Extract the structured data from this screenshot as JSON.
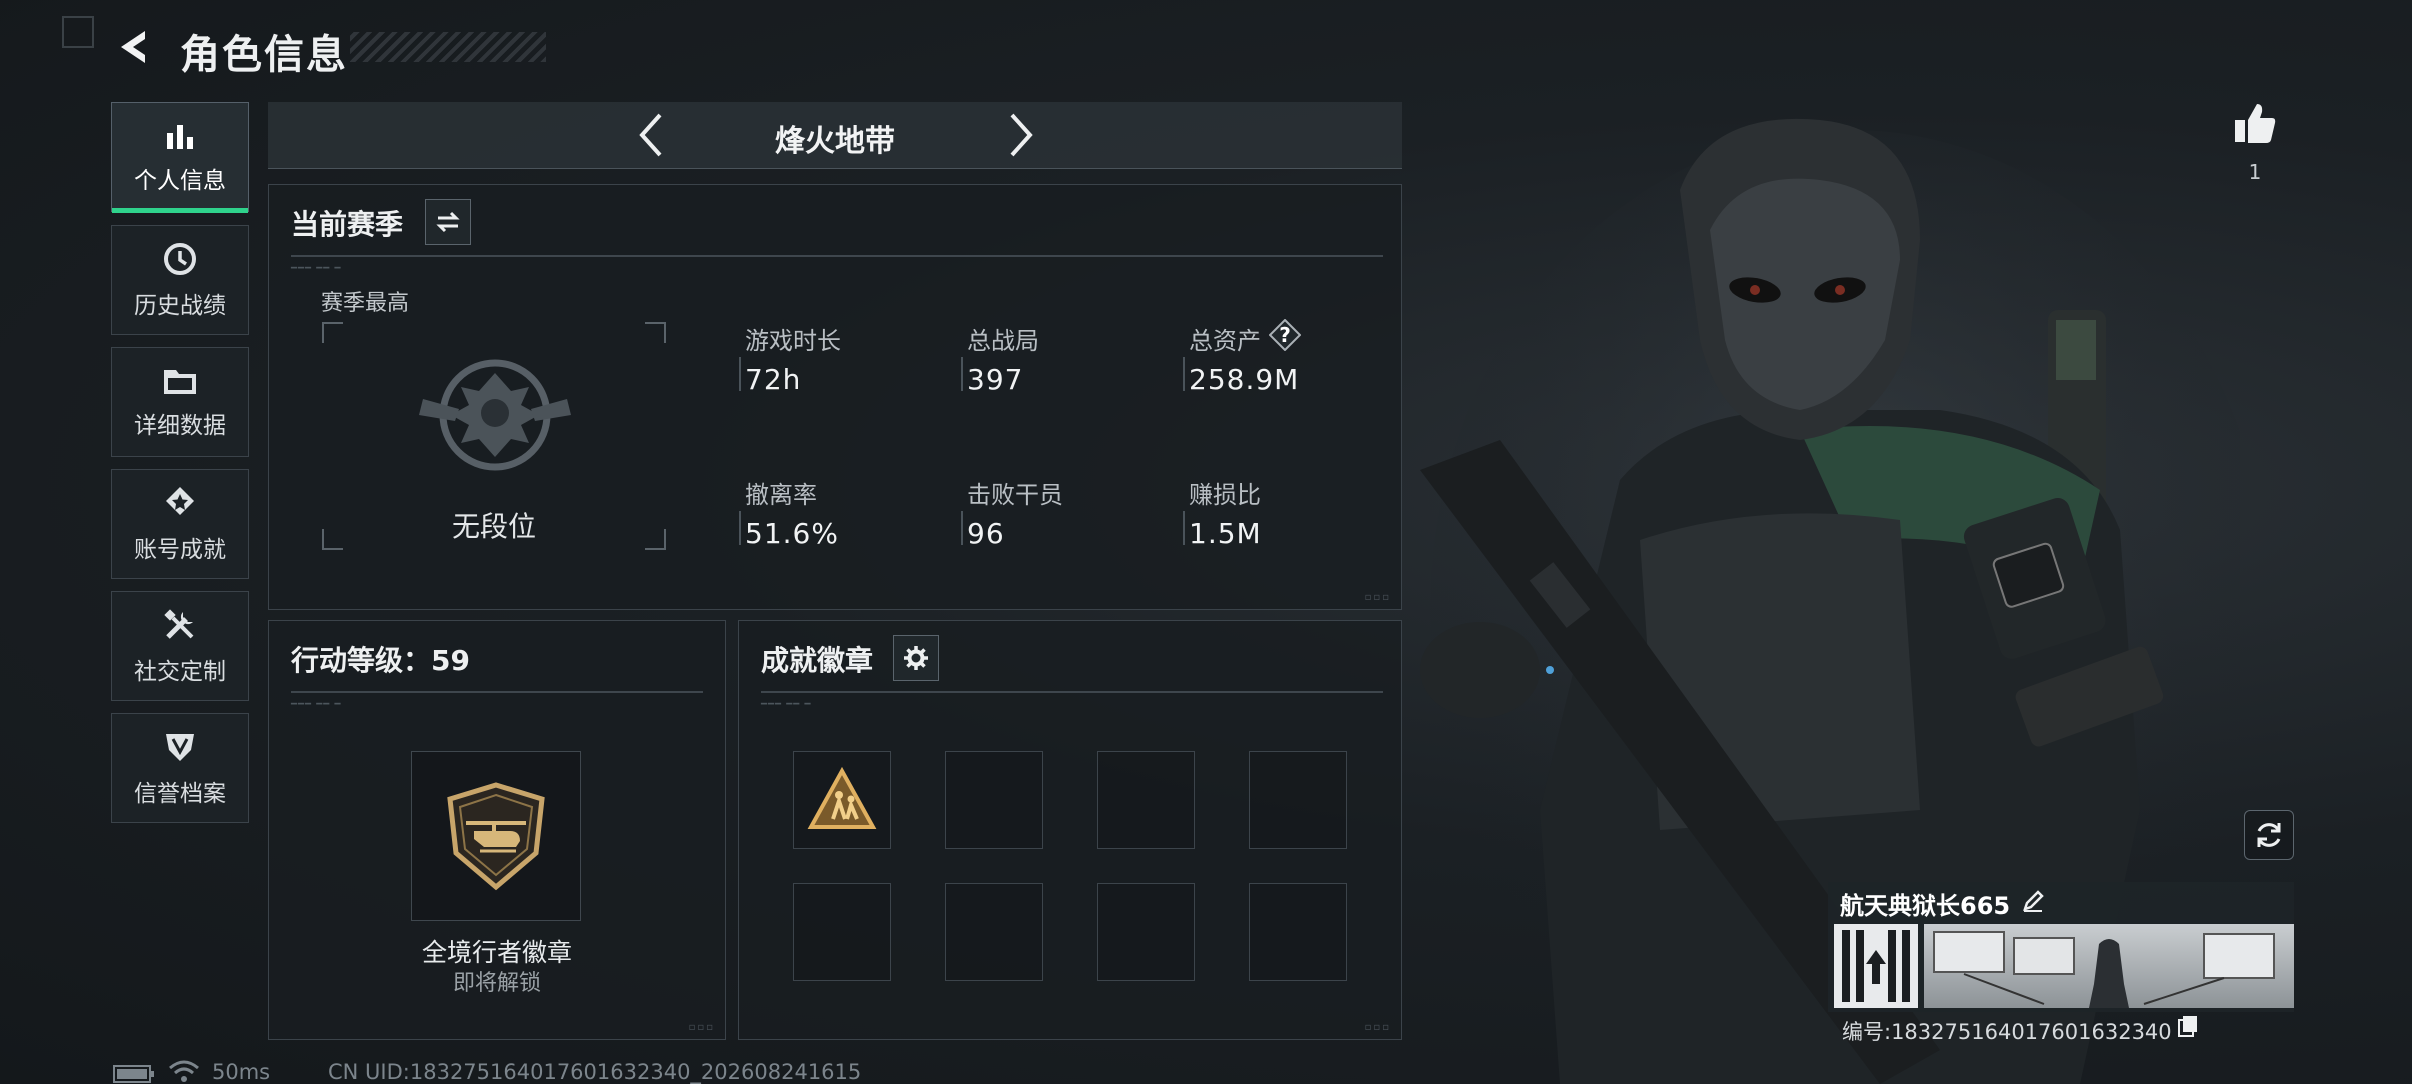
{
  "header": {
    "title": "角色信息",
    "back_icon": "back-arrow-icon"
  },
  "sidebar": {
    "items": [
      {
        "label": "个人信息",
        "icon": "bar-chart-icon",
        "active": true
      },
      {
        "label": "历史战绩",
        "icon": "history-clock-icon",
        "active": false
      },
      {
        "label": "详细数据",
        "icon": "folder-icon",
        "active": false
      },
      {
        "label": "账号成就",
        "icon": "achievement-icon",
        "active": false
      },
      {
        "label": "社交定制",
        "icon": "tools-icon",
        "active": false
      },
      {
        "label": "信誉档案",
        "icon": "shield-icon",
        "active": false
      }
    ],
    "accent_color": "#2fd38c"
  },
  "mode_tab": {
    "label": "烽火地带"
  },
  "season": {
    "heading": "当前赛季",
    "best_label": "赛季最高",
    "rank": "无段位",
    "stats": [
      {
        "label": "游戏时长",
        "value": "72h"
      },
      {
        "label": "总战局",
        "value": "397"
      },
      {
        "label": "总资产",
        "value": "258.9M",
        "help": "?"
      },
      {
        "label": "撤离率",
        "value": "51.6%"
      },
      {
        "label": "击败干员",
        "value": "96"
      },
      {
        "label": "赚损比",
        "value": "1.5M"
      }
    ]
  },
  "action_level": {
    "heading": "行动等级：59",
    "badge_name": "全境行者徽章",
    "badge_status": "即将解锁"
  },
  "achievements": {
    "heading": "成就徽章",
    "slots_total": 8,
    "slots_filled": 1
  },
  "profile": {
    "likes": "1",
    "player_name": "航天典狱长665",
    "player_id": "编号:1832751640176016323​40"
  },
  "footer": {
    "ping": "50ms",
    "uid": "CN UID:18327516401760163​2340_202608241615"
  }
}
